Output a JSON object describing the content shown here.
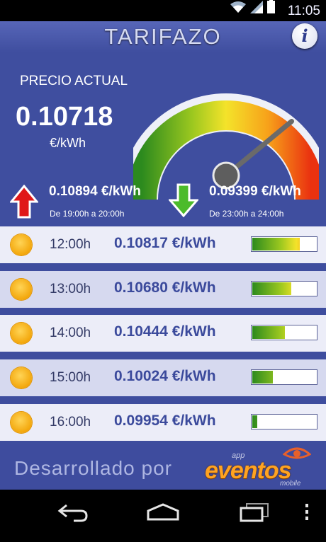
{
  "status": {
    "time": "11:05"
  },
  "header": {
    "title": "TARIFAZO",
    "info_label": "i"
  },
  "current": {
    "label": "PRECIO ACTUAL",
    "value": "0.10718",
    "unit": "€/kWh",
    "gauge_level": 0.78
  },
  "max": {
    "price": "0.10894 €/kWh",
    "time": "De 19:00h a 20:00h"
  },
  "min": {
    "price": "0.09399 €/kWh",
    "time": "De 23:00h a 24:00h"
  },
  "hours": [
    {
      "hour": "12:00h",
      "price": "0.10817 €/kWh",
      "level": 0.73
    },
    {
      "hour": "13:00h",
      "price": "0.10680 €/kWh",
      "level": 0.6
    },
    {
      "hour": "14:00h",
      "price": "0.10444 €/kWh",
      "level": 0.5
    },
    {
      "hour": "15:00h",
      "price": "0.10024 €/kWh",
      "level": 0.31
    },
    {
      "hour": "16:00h",
      "price": "0.09954 €/kWh",
      "level": 0.08
    }
  ],
  "footer": {
    "developed_by": "Desarrollado por",
    "logo_app": "app",
    "logo_name": "eventos",
    "logo_mobile": "mobile"
  },
  "colors": {
    "app_bg": "#3e4d9e",
    "row_light": "#ecedf8",
    "row_dark": "#d6d9ef",
    "price_text": "#3b4a9c",
    "up_arrow": "#e01818",
    "down_arrow": "#4cbb2a"
  },
  "icons": [
    "wifi-icon",
    "signal-icon",
    "battery-icon",
    "info-icon",
    "up-arrow-icon",
    "down-arrow-icon",
    "sun-icon",
    "back-icon",
    "home-icon",
    "recents-icon",
    "overflow-menu-icon"
  ]
}
